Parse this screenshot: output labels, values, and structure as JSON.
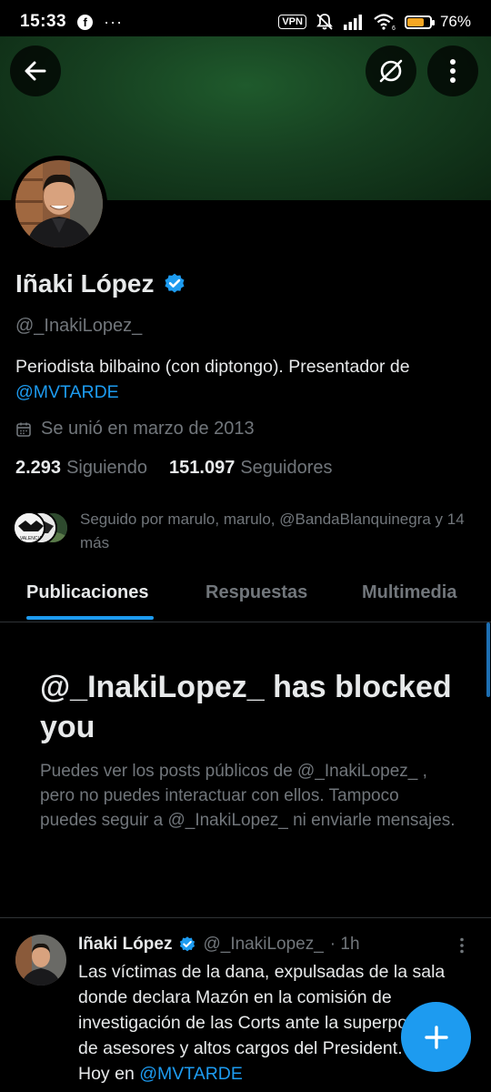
{
  "status_bar": {
    "time": "15:33",
    "dots": "···",
    "vpn": "VPN",
    "wifi_badge": "6",
    "battery_percent": "76%",
    "battery_level": 0.76,
    "battery_color": "#f5a623"
  },
  "header": {
    "back_icon": "arrow-left-icon",
    "grok_icon": "grok-icon",
    "more_icon": "more-vertical-icon"
  },
  "profile": {
    "name": "Iñaki López",
    "handle": "@_InakiLopez_",
    "bio_text": "Periodista bilbaino (con diptongo). Presentador de ",
    "bio_mention": "@MVTARDE",
    "joined": "Se unió en marzo de 2013",
    "following_count": "2.293",
    "following_label": "Siguiendo",
    "followers_count": "151.097",
    "followers_label": "Seguidores",
    "followed_by": "Seguido por marulo, marulo, @BandaBlanquinegra y 14 más",
    "verified_color": "#1d9bf0",
    "mini_avatar_text": "VALENCIA"
  },
  "tabs": [
    {
      "label": "Publicaciones",
      "active": true
    },
    {
      "label": "Respuestas",
      "active": false
    },
    {
      "label": "Multimedia",
      "active": false
    }
  ],
  "blocked": {
    "title": "@_InakiLopez_ has blocked you",
    "body": "Puedes ver los posts públicos de @_InakiLopez_ , pero no puedes interactuar con ellos. Tampoco puedes seguir a @_InakiLopez_ ni enviarle mensajes."
  },
  "post": {
    "author": "Iñaki López",
    "handle": "@_InakiLopez_",
    "time": "· 1h",
    "text": "Las víctimas de la dana, expulsadas de la sala donde declara Mazón en la comisión de investigación de las Corts ante la superpoblación de asesores y altos cargos del President.",
    "partial_text": "Hoy en ",
    "partial_mention": "@MVTARDE"
  },
  "fab": {
    "icon": "plus-icon"
  },
  "colors": {
    "accent": "#1d9bf0",
    "background": "#000000",
    "muted": "#71767b"
  }
}
